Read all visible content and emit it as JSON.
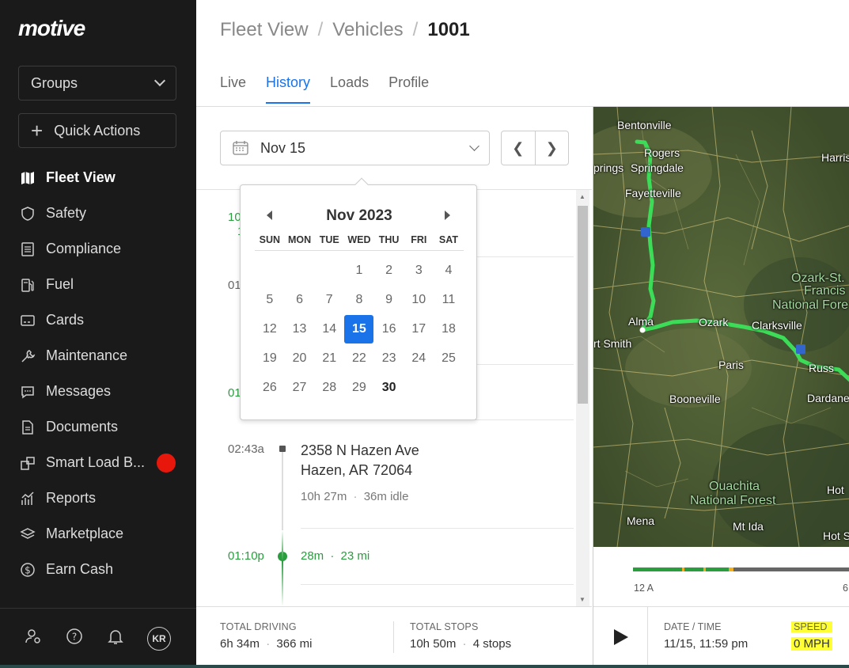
{
  "sidebar": {
    "logo": "motive",
    "groups_label": "Groups",
    "quick_actions_label": "Quick Actions",
    "items": [
      {
        "label": "Fleet View",
        "icon": "map-icon"
      },
      {
        "label": "Safety",
        "icon": "shield-icon"
      },
      {
        "label": "Compliance",
        "icon": "list-icon"
      },
      {
        "label": "Fuel",
        "icon": "fuel-icon"
      },
      {
        "label": "Cards",
        "icon": "card-icon"
      },
      {
        "label": "Maintenance",
        "icon": "wrench-icon"
      },
      {
        "label": "Messages",
        "icon": "message-icon"
      },
      {
        "label": "Documents",
        "icon": "document-icon"
      },
      {
        "label": "Smart Load B...",
        "icon": "load-board-icon"
      },
      {
        "label": "Reports",
        "icon": "reports-icon"
      },
      {
        "label": "Marketplace",
        "icon": "layers-icon"
      },
      {
        "label": "Earn Cash",
        "icon": "dollar-icon"
      }
    ],
    "avatar_initials": "KR"
  },
  "breadcrumb": {
    "root": "Fleet View",
    "sep": "/",
    "middle": "Vehicles",
    "current": "1001"
  },
  "tabs": [
    "Live",
    "History",
    "Loads",
    "Profile"
  ],
  "date_select": {
    "value": "Nov 15"
  },
  "calendar": {
    "title": "Nov 2023",
    "dow": [
      "SUN",
      "MON",
      "TUE",
      "WED",
      "THU",
      "FRI",
      "SAT"
    ],
    "days": [
      "",
      "",
      "",
      "1",
      "2",
      "3",
      "4",
      "5",
      "6",
      "7",
      "8",
      "9",
      "10",
      "11",
      "12",
      "13",
      "14",
      "15",
      "16",
      "17",
      "18",
      "19",
      "20",
      "21",
      "22",
      "23",
      "24",
      "25",
      "26",
      "27",
      "28",
      "29",
      "30"
    ],
    "selected": "15",
    "today": "30"
  },
  "timeline": {
    "partial_times": [
      "10",
      "1",
      "01",
      "01"
    ],
    "stop": {
      "time": "02:43a",
      "address_line1": "2358 N Hazen Ave",
      "address_line2": "Hazen, AR 72064",
      "duration": "10h 27m",
      "idle": "36m idle"
    },
    "drive": {
      "time": "01:10p",
      "duration": "28m",
      "distance": "23 mi"
    }
  },
  "stats": {
    "driving_label": "TOTAL DRIVING",
    "driving_time": "6h 34m",
    "driving_dist": "366 mi",
    "stops_label": "TOTAL STOPS",
    "stops_time": "10h 50m",
    "stops_count": "4 stops",
    "dot": "·"
  },
  "map": {
    "labels": [
      "Bentonville",
      "Rogers",
      "prings",
      "Springdale",
      "Fayetteville",
      "Harris",
      "Ozark-St.",
      "Francis",
      "National Fore",
      "Alma",
      "Ozark",
      "Clarksville",
      "rt Smith",
      "Paris",
      "Russ",
      "Dardane",
      "Booneville",
      "Ouachita",
      "National Forest",
      "Hot",
      "Mena",
      "Mt Ida",
      "Hot S"
    ]
  },
  "playback": {
    "tick_start": "12 A",
    "tick_end": "6",
    "datetime_label": "DATE / TIME",
    "datetime_value": "11/15, 11:59 pm",
    "speed_label": "SPEED",
    "speed_value": "0 MPH"
  },
  "colors": {
    "accent": "#1a73e8",
    "green": "#2a9d3f",
    "route": "#3ddc58",
    "badge_red": "#e8170b",
    "highlight": "#ffff33"
  }
}
